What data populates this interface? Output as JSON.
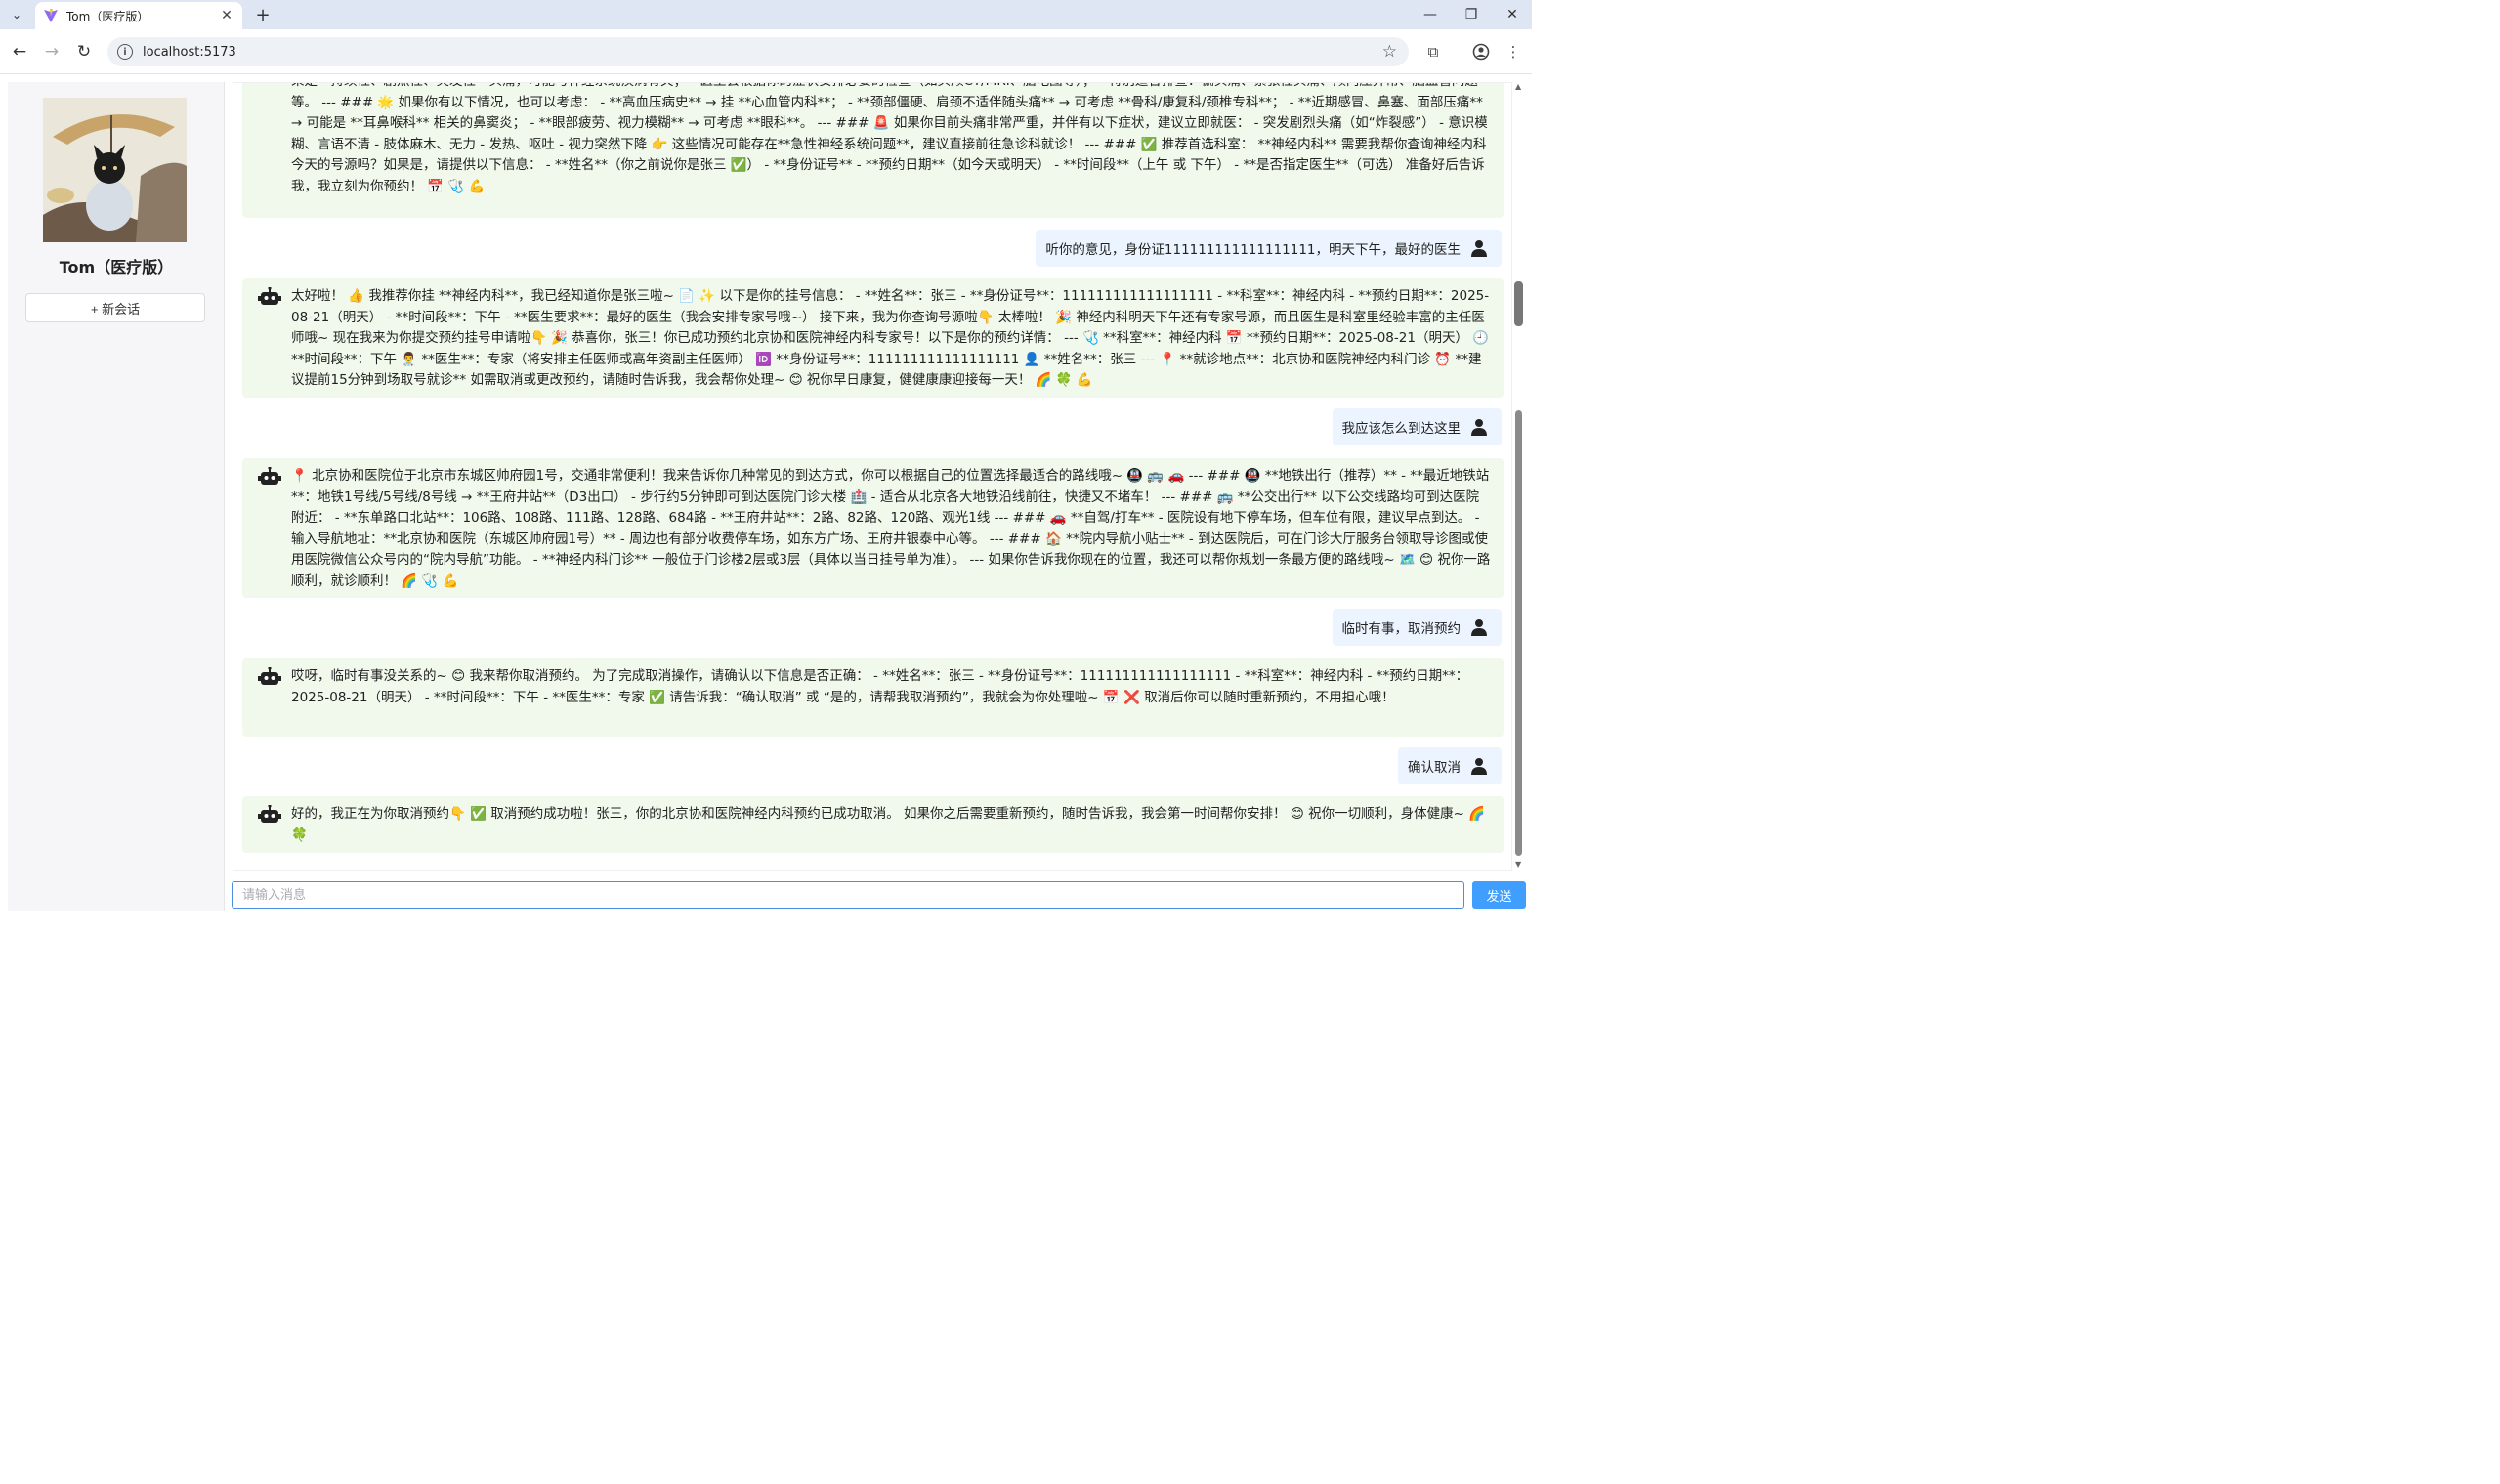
{
  "browser": {
    "tab_title": "Tom（医疗版）",
    "url": "localhost:5173",
    "icons": [
      "tab-list-icon",
      "close-icon",
      "plus-icon",
      "minimize-icon",
      "restore-icon",
      "close-window-icon",
      "back-icon",
      "forward-icon",
      "reload-icon",
      "info-icon",
      "star-icon",
      "extensions-icon",
      "profile-icon",
      "menu-icon"
    ]
  },
  "sidebar": {
    "profile_name": "Tom（医疗版）",
    "new_chat_label": "+ 新会话"
  },
  "messages": [
    {
      "role": "bot",
      "text": "果是**持续性、剧烈性、突发性**头痛，可能与神经系统疾病有关； - 医生会根据你的症状安排必要的检查（如头颅CT/MRI、脑电图等）； - 特别适合排查：偏头痛、紧张性头痛、颅内压异常、脑血管问题等。 --- ### 🌟 如果你有以下情况，也可以考虑： - **高血压病史** → 挂 **心血管内科**； - **颈部僵硬、肩颈不适伴随头痛** → 可考虑 **骨科/康复科/颈椎专科**； - **近期感冒、鼻塞、面部压痛** → 可能是 **耳鼻喉科** 相关的鼻窦炎； - **眼部疲劳、视力模糊** → 可考虑 **眼科**。 --- ### 🚨 如果你目前头痛非常严重，并伴有以下症状，建议立即就医： - 突发剧烈头痛（如“炸裂感”） - 意识模糊、言语不清 - 肢体麻木、无力 - 发热、呕吐 - 视力突然下降 👉 这些情况可能存在**急性神经系统问题**，建议直接前往急诊科就诊！ --- ### ✅ 推荐首选科室： **神经内科** 需要我帮你查询神经内科今天的号源吗？如果是，请提供以下信息： - **姓名**（你之前说你是张三 ✅） - **身份证号** - **预约日期**（如今天或明天） - **时间段**（上午 或 下午） - **是否指定医生**（可选） 准备好后告诉我，我立刻为你预约！ 📅 🩺 💪"
    },
    {
      "role": "user",
      "text": "听你的意见，身份证111111111111111111，明天下午，最好的医生"
    },
    {
      "role": "bot",
      "text": "太好啦！ 👍 我推荐你挂 **神经内科**，我已经知道你是张三啦~ 📄 ✨ 以下是你的挂号信息： - **姓名**：张三 - **身份证号**：111111111111111111 - **科室**：神经内科 - **预约日期**：2025-08-21（明天） - **时间段**：下午 - **医生要求**：最好的医生（我会安排专家号哦~） 接下来，我为你查询号源啦👇 太棒啦！ 🎉 神经内科明天下午还有专家号源，而且医生是科室里经验丰富的主任医师哦~ 现在我来为你提交预约挂号申请啦👇 🎉 恭喜你，张三！你已成功预约北京协和医院神经内科专家号！以下是你的预约详情： --- 🩺 **科室**：神经内科 📅 **预约日期**：2025-08-21（明天） 🕘 **时间段**：下午 👨‍⚕️ **医生**：专家（将安排主任医师或高年资副主任医师） 🆔 **身份证号**：111111111111111111 👤 **姓名**：张三 --- 📍 **就诊地点**：北京协和医院神经内科门诊 ⏰ **建议提前15分钟到场取号就诊** 如需取消或更改预约，请随时告诉我，我会帮你处理~ 😊 祝你早日康复，健健康康迎接每一天！ 🌈 🍀 💪"
    },
    {
      "role": "user",
      "text": "我应该怎么到达这里"
    },
    {
      "role": "bot",
      "text": "📍 北京协和医院位于北京市东城区帅府园1号，交通非常便利！我来告诉你几种常见的到达方式，你可以根据自己的位置选择最适合的路线哦~ 🚇 🚌 🚗 --- ### 🚇 **地铁出行（推荐）** - **最近地铁站**：地铁1号线/5号线/8号线 → **王府井站**（D3出口） - 步行约5分钟即可到达医院门诊大楼 🏥 - 适合从北京各大地铁沿线前往，快捷又不堵车！ --- ### 🚌 **公交出行** 以下公交线路均可到达医院附近： - **东单路口北站**：106路、108路、111路、128路、684路 - **王府井站**：2路、82路、120路、观光1线 --- ### 🚗 **自驾/打车** - 医院设有地下停车场，但车位有限，建议早点到达。 - 输入导航地址：**北京协和医院（东城区帅府园1号）** - 周边也有部分收费停车场，如东方广场、王府井银泰中心等。 --- ### 🏠 **院内导航小贴士** - 到达医院后，可在门诊大厅服务台领取导诊图或使用医院微信公众号内的“院内导航”功能。 - **神经内科门诊** 一般位于门诊楼2层或3层（具体以当日挂号单为准）。 --- 如果你告诉我你现在的位置，我还可以帮你规划一条最方便的路线哦~ 🗺️ 😊 祝你一路顺利，就诊顺利！ 🌈 🩺 💪"
    },
    {
      "role": "user",
      "text": "临时有事，取消预约"
    },
    {
      "role": "bot",
      "text": "哎呀，临时有事没关系的~ 😊 我来帮你取消预约。 为了完成取消操作，请确认以下信息是否正确： - **姓名**：张三 - **身份证号**：111111111111111111 - **科室**：神经内科 - **预约日期**：2025-08-21（明天） - **时间段**：下午 - **医生**：专家 ✅ 请告诉我：“确认取消” 或 “是的，请帮我取消预约”，我就会为你处理啦~ 📅 ❌ 取消后你可以随时重新预约，不用担心哦！"
    },
    {
      "role": "user",
      "text": "确认取消"
    },
    {
      "role": "bot",
      "text": "好的，我正在为你取消预约👇 ✅ 取消预约成功啦！张三，你的北京协和医院神经内科预约已成功取消。 如果你之后需要重新预约，随时告诉我，我会第一时间帮你安排！ 😊 祝你一切顺利，身体健康~ 🌈 🍀"
    }
  ],
  "input": {
    "placeholder": "请输入消息",
    "value": ""
  },
  "send_label": "发送",
  "colors": {
    "bot_bubble": "#f0f9eb",
    "user_bubble": "#ecf5ff",
    "send_button": "#409eff",
    "input_border": "#4a8fe0",
    "tabstrip": "#dee6f4"
  }
}
